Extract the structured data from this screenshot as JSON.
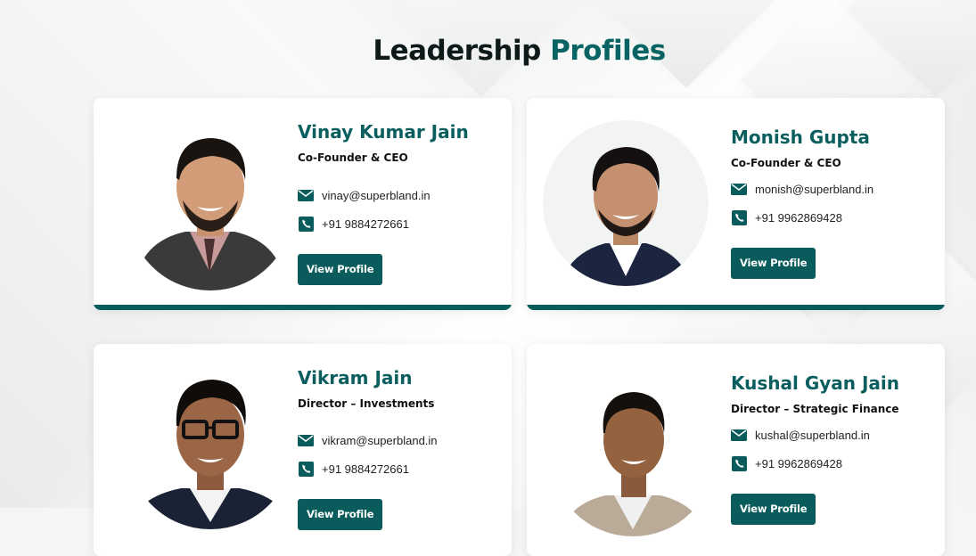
{
  "page": {
    "title_main": "Leadership",
    "title_accent": "Profiles"
  },
  "profiles": [
    {
      "name": "Vinay Kumar Jain",
      "role": "Co-Founder & CEO",
      "email": "vinay@superbland.in",
      "phone": "+91 9884272661",
      "button": "View Profile"
    },
    {
      "name": "Monish Gupta",
      "role": "Co-Founder & CEO",
      "email": "monish@superbland.in",
      "phone": "+91 9962869428",
      "button": "View Profile"
    },
    {
      "name": "Vikram Jain",
      "role": "Director – Investments",
      "email": "vikram@superbland.in",
      "phone": "+91 9884272661",
      "button": "View Profile"
    },
    {
      "name": "Kushal Gyan Jain",
      "role": "Director – Strategic Finance",
      "email": "kushal@superbland.in",
      "phone": "+91 9962869428",
      "button": "View Profile"
    }
  ],
  "icons": {
    "email": "envelope-icon",
    "phone": "phone-icon"
  },
  "colors": {
    "accent": "#0a5c5c",
    "title_accent": "#0a6363",
    "name": "#0b5e5e"
  }
}
